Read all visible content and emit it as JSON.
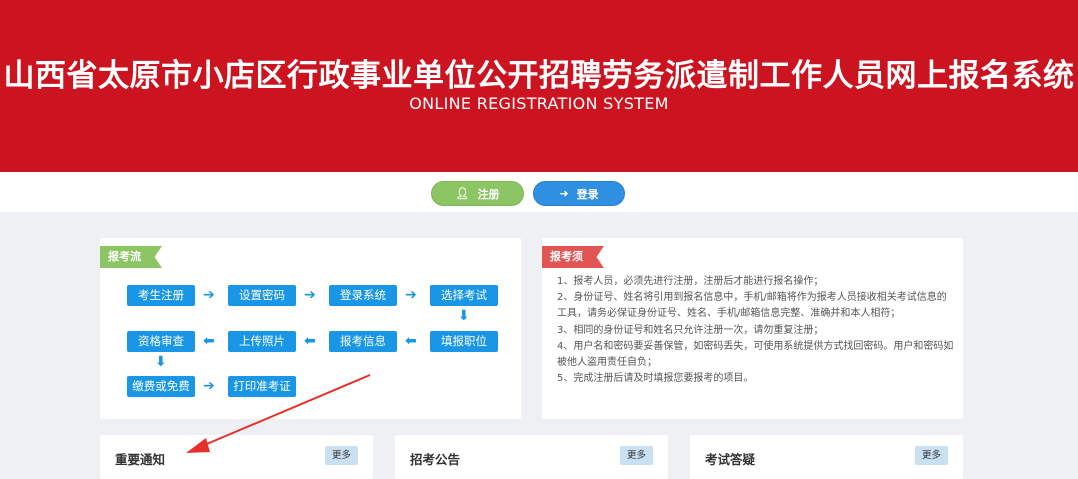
{
  "header": {
    "title": "山西省太原市小店区行政事业单位公开招聘劳务派遣制工作人员网上报名系统",
    "subtitle": "ONLINE REGISTRATION SYSTEM"
  },
  "auth": {
    "register_label": "注册",
    "login_label": "登录"
  },
  "flow": {
    "ribbon": "报考流程",
    "steps": [
      "考生注册",
      "设置密码",
      "登录系统",
      "选择考试",
      "填报职位",
      "报考信息",
      "上传照片",
      "资格审查",
      "缴费或免费",
      "打印准考证"
    ]
  },
  "notice": {
    "ribbon": "报考须知",
    "items": [
      "1、报考人员，必须先进行注册，注册后才能进行报名操作；",
      "2、身份证号、姓名将引用到报名信息中，手机/邮箱将作为报考人员接收相关考试信息的工具，请务必保证身份证号、姓名、手机/邮箱信息完整、准确并和本人相符；",
      "3、相同的身份证号和姓名只允许注册一次，请勿重复注册；",
      "4、用户名和密码要妥善保管，如密码丢失，可使用系统提供方式找回密码。用户和密码如被他人盗用责任自负；",
      "5、完成注册后请及时填报您要报考的项目。"
    ]
  },
  "cards": [
    {
      "title": "重要通知",
      "more": "更多"
    },
    {
      "title": "招考公告",
      "more": "更多"
    },
    {
      "title": "考试答疑",
      "more": "更多"
    }
  ],
  "colors": {
    "banner": "#cc1421",
    "green": "#8cc664",
    "blue": "#2f8fe0",
    "step_blue": "#1a96e6",
    "annotation_red": "#e8302a"
  }
}
